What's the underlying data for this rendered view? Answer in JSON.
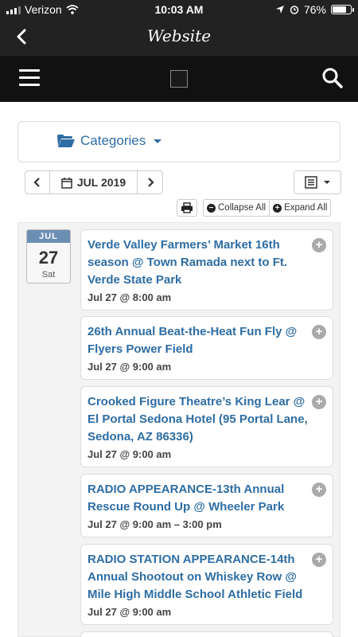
{
  "status_bar": {
    "carrier": "Verizon",
    "time": "10:03 AM",
    "battery": "76%",
    "battery_level": 0.76
  },
  "nav": {
    "title": "Website"
  },
  "categories": {
    "label": "Categories"
  },
  "calendar": {
    "month_label": "JUL 2019",
    "collapse_label": "Collapse All",
    "expand_label": "Expand All"
  },
  "day": {
    "month": "JUL",
    "day": "27",
    "dow": "Sat"
  },
  "events": [
    {
      "title": "Verde Valley Farmers’ Market  16th season @ Town Ramada next to Ft. Verde State Park",
      "time": "Jul 27 @ 8:00 am"
    },
    {
      "title": "26th Annual Beat-the-Heat Fun Fly @ Flyers Power Field",
      "time": "Jul 27 @ 9:00 am"
    },
    {
      "title": "Crooked Figure Theatre’s King Lear @ El Portal Sedona Hotel (95 Portal Lane, Sedona, AZ 86336)",
      "time": "Jul 27 @ 9:00 am"
    },
    {
      "title": "RADIO APPEARANCE-13th Annual Rescue Round Up @ Wheeler Park",
      "time": "Jul 27 @ 9:00 am – 3:00 pm"
    },
    {
      "title": "RADIO STATION APPEARANCE-14th Annual Shootout on Whiskey Row @ Mile High Middle School Athletic Field",
      "time": "Jul 27 @ 9:00 am"
    }
  ],
  "colors": {
    "accent": "#2e6da4",
    "header": "#111111",
    "date_badge": "#6b8fb3"
  }
}
